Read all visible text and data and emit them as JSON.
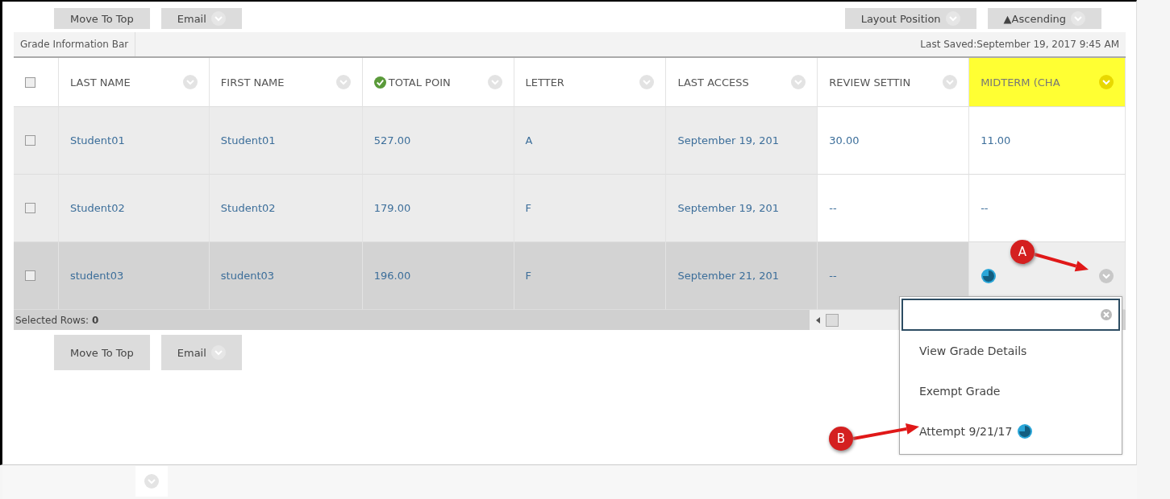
{
  "top_toolbar": {
    "left_buttons": [
      {
        "label": "Move To Top",
        "kind": "plain"
      },
      {
        "label": "Email",
        "kind": "menu"
      }
    ],
    "right_buttons": [
      {
        "label": "Layout Position",
        "kind": "menu"
      },
      {
        "label": "▲Ascending",
        "kind": "menu"
      }
    ]
  },
  "info_bar": {
    "title": "Grade Information Bar",
    "last_saved": "Last Saved:September 19, 2017 9:45 AM"
  },
  "table": {
    "select_all_checked": false,
    "columns": [
      {
        "label": "LAST NAME",
        "kind": "plain",
        "highlighted": false
      },
      {
        "label": "FIRST NAME",
        "kind": "plain",
        "highlighted": false
      },
      {
        "label": "TOTAL POIN",
        "kind": "graded",
        "highlighted": false
      },
      {
        "label": "LETTER",
        "kind": "plain",
        "highlighted": false
      },
      {
        "label": "LAST ACCESS",
        "kind": "plain",
        "highlighted": false
      },
      {
        "label": "REVIEW SETTIN",
        "kind": "plain",
        "highlighted": false
      },
      {
        "label": "MIDTERM (CHA",
        "kind": "plain",
        "highlighted": true
      }
    ],
    "rows": [
      {
        "checked": false,
        "hovered": false,
        "cells": [
          {
            "kind": "text",
            "text": "Student01"
          },
          {
            "kind": "text",
            "text": "Student01"
          },
          {
            "kind": "text",
            "text": "527.00"
          },
          {
            "kind": "text",
            "text": "A"
          },
          {
            "kind": "text",
            "text": "September 19, 201"
          },
          {
            "kind": "text",
            "text": "30.00"
          },
          {
            "kind": "text",
            "text": "11.00"
          }
        ]
      },
      {
        "checked": false,
        "hovered": false,
        "cells": [
          {
            "kind": "text",
            "text": "Student02"
          },
          {
            "kind": "text",
            "text": "Student02"
          },
          {
            "kind": "text",
            "text": "179.00"
          },
          {
            "kind": "text",
            "text": "F"
          },
          {
            "kind": "text",
            "text": "September 19, 201"
          },
          {
            "kind": "text",
            "text": "--"
          },
          {
            "kind": "text",
            "text": "--"
          }
        ]
      },
      {
        "checked": false,
        "hovered": true,
        "cells": [
          {
            "kind": "text",
            "text": "student03"
          },
          {
            "kind": "text",
            "text": "student03"
          },
          {
            "kind": "text",
            "text": "196.00"
          },
          {
            "kind": "text",
            "text": "F"
          },
          {
            "kind": "text",
            "text": "September 21, 201"
          },
          {
            "kind": "text",
            "text": "--"
          },
          {
            "kind": "attempt"
          }
        ]
      }
    ],
    "selected_rows": "Selected Rows: **0**"
  },
  "bottom_toolbar": {
    "buttons": [
      {
        "label": "Move To Top",
        "kind": "plain"
      },
      {
        "label": "Email",
        "kind": "menu"
      }
    ]
  },
  "context_menu": {
    "items": [
      {
        "label": "View Grade Details",
        "kind": "plain"
      },
      {
        "label": "Exempt Grade",
        "kind": "plain"
      },
      {
        "label": "Attempt 9/21/17",
        "kind": "attempt"
      }
    ]
  },
  "callouts": [
    {
      "label": "A"
    },
    {
      "label": "B"
    }
  ]
}
